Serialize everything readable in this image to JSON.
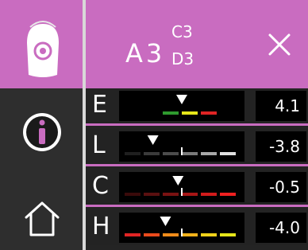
{
  "header": {
    "shade_main": "A3",
    "shade_upper": "C3",
    "shade_lower": "D3"
  },
  "sidebar": {
    "items": [
      "device-icon",
      "info-icon",
      "home-icon"
    ]
  },
  "rows": [
    {
      "letter": "E",
      "value": "4.1",
      "scale": "E",
      "pointer": 0.5,
      "tick": null,
      "segments": [
        null,
        null,
        "#2e9a2e",
        "#e6e61a",
        "#e02424",
        null
      ]
    },
    {
      "letter": "L",
      "value": "-3.8",
      "scale": "L",
      "pointer": 0.27,
      "tick": 0.5,
      "segments": [
        "#1f1f1f",
        "#3a3a3a",
        "#4c4c4c",
        "#7a7a7a",
        "#a8a8a8",
        "#e0e0e0"
      ]
    },
    {
      "letter": "C",
      "value": "-0.5",
      "scale": "C",
      "pointer": 0.47,
      "tick": 0.5,
      "segments": [
        "#3a0a0a",
        "#5a1010",
        "#7a1212",
        "#a81616",
        "#d21c1c",
        "#f02020"
      ]
    },
    {
      "letter": "H",
      "value": "-4.0",
      "scale": "H",
      "pointer": 0.37,
      "tick": 0.5,
      "segments": [
        "#e02424",
        "#ea4a1c",
        "#f08c1a",
        "#f2b21a",
        "#f0d21a",
        "#e6e61a"
      ]
    }
  ],
  "colors": {
    "accent": "#c96cc0",
    "sidebar": "#2e2e2e",
    "divider": "#d8d8d8"
  }
}
